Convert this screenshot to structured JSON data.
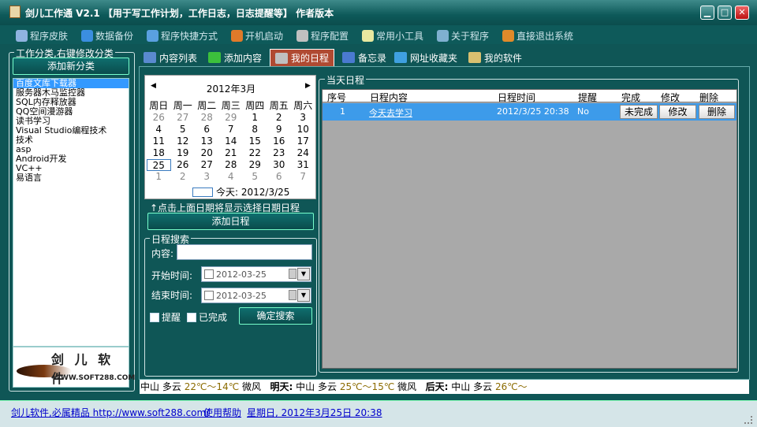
{
  "window": {
    "title": "剑儿工作通 V2.1 【用于写工作计划，工作日志，日志提醒等】 作者版本",
    "min_glyph": "▁",
    "max_glyph": "□",
    "close_glyph": "✕"
  },
  "menu": [
    {
      "label": "程序皮肤",
      "icon": "palette-icon",
      "color": "#8fb3e0"
    },
    {
      "label": "数据备份",
      "icon": "globe-icon",
      "color": "#3b8ee0"
    },
    {
      "label": "程序快捷方式",
      "icon": "shortcut-icon",
      "color": "#5aa0e0"
    },
    {
      "label": "开机启动",
      "icon": "lifebuoy-icon",
      "color": "#e07a2a"
    },
    {
      "label": "程序配置",
      "icon": "tools-icon",
      "color": "#c0c0c0"
    },
    {
      "label": "常用小工具",
      "icon": "bulb-icon",
      "color": "#e8e8a0"
    },
    {
      "label": "关于程序",
      "icon": "monitor-icon",
      "color": "#7fb0d0"
    },
    {
      "label": "直接退出系统",
      "icon": "exit-icon",
      "color": "#e08a2a"
    }
  ],
  "left": {
    "group_title": "工作分类,右键修改分类",
    "add_button": "添加新分类",
    "categories": [
      "百度文库下载器",
      "服务器木马监控器",
      "SQL内存释放器",
      "QQ空间漫游器",
      "读书学习",
      "Visual Studio编程技术",
      "技术",
      "asp",
      "Android开发",
      "VC++",
      "易语言"
    ],
    "selected_index": 0,
    "logo_text": "剑 儿 软 件",
    "logo_url": "WWW.SOFT288.COM"
  },
  "tabs": [
    {
      "label": "内容列表",
      "icon": "list-icon",
      "color": "#5a8ad0",
      "active": false
    },
    {
      "label": "添加内容",
      "icon": "plus-icon",
      "color": "#3cc03c",
      "active": false
    },
    {
      "label": "我的日程",
      "icon": "schedule-icon",
      "color": "#c0c0c0",
      "active": true
    },
    {
      "label": "备忘录",
      "icon": "memo-icon",
      "color": "#4a7ad0",
      "active": false
    },
    {
      "label": "网址收藏夹",
      "icon": "globe-icon",
      "color": "#3fa0e0",
      "active": false
    },
    {
      "label": "我的软件",
      "icon": "tools-icon",
      "color": "#d8c070",
      "active": false
    }
  ],
  "calendar": {
    "month_label": "2012年3月",
    "prev": "◀",
    "next": "▶",
    "weekdays": [
      "周日",
      "周一",
      "周二",
      "周三",
      "周四",
      "周五",
      "周六"
    ],
    "weeks": [
      [
        "26",
        "27",
        "28",
        "29",
        "1",
        "2",
        "3"
      ],
      [
        "4",
        "5",
        "6",
        "7",
        "8",
        "9",
        "10"
      ],
      [
        "11",
        "12",
        "13",
        "14",
        "15",
        "16",
        "17"
      ],
      [
        "18",
        "19",
        "20",
        "21",
        "22",
        "23",
        "24"
      ],
      [
        "25",
        "26",
        "27",
        "28",
        "29",
        "30",
        "31"
      ],
      [
        "1",
        "2",
        "3",
        "4",
        "5",
        "6",
        "7"
      ]
    ],
    "dim_cells": [
      [
        0,
        0
      ],
      [
        0,
        1
      ],
      [
        0,
        2
      ],
      [
        0,
        3
      ],
      [
        5,
        0
      ],
      [
        5,
        1
      ],
      [
        5,
        2
      ],
      [
        5,
        3
      ],
      [
        5,
        4
      ],
      [
        5,
        5
      ],
      [
        5,
        6
      ]
    ],
    "today_cell": [
      4,
      0
    ],
    "today_label": "今天: 2012/3/25"
  },
  "hint": "↑点击上面日期将显示选择日期日程",
  "add_schedule_button": "添加日程",
  "search": {
    "group_title": "日程搜索",
    "content_label": "内容:",
    "content_value": "",
    "start_label": "开始时间:",
    "start_value": "2012-03-25",
    "end_label": "结束时间:",
    "end_value": "2012-03-25",
    "remind_label": "提醒",
    "done_label": "已完成",
    "search_button": "确定搜索"
  },
  "today_schedule": {
    "group_title": "当天日程",
    "columns": [
      "序号",
      "日程内容",
      "日程时间",
      "提醒",
      "完成",
      "修改",
      "删除"
    ],
    "rows": [
      {
        "index": "1",
        "content": "今天去学习",
        "time": "2012/3/25 20:38",
        "remind": "No",
        "done_btn": "未完成",
        "edit_btn": "修改",
        "delete_btn": "删除"
      }
    ]
  },
  "weather": {
    "city": "中山",
    "today_cond": "多云",
    "today_temp": "22℃～14℃",
    "today_wind": "微风",
    "tomorrow_label": "明天:",
    "tomorrow_city": "中山",
    "tomorrow_cond": "多云",
    "tomorrow_temp": "25℃～15℃",
    "tomorrow_wind": "微风",
    "after_label": "后天:",
    "after_city": "中山",
    "after_cond": "多云",
    "after_temp": "26℃～"
  },
  "status": {
    "site_link": "剑儿软件,必属精品 http://www.soft288.com/",
    "help_link": "使用帮助",
    "datetime": "星期日, 2012年3月25日 20:38"
  }
}
